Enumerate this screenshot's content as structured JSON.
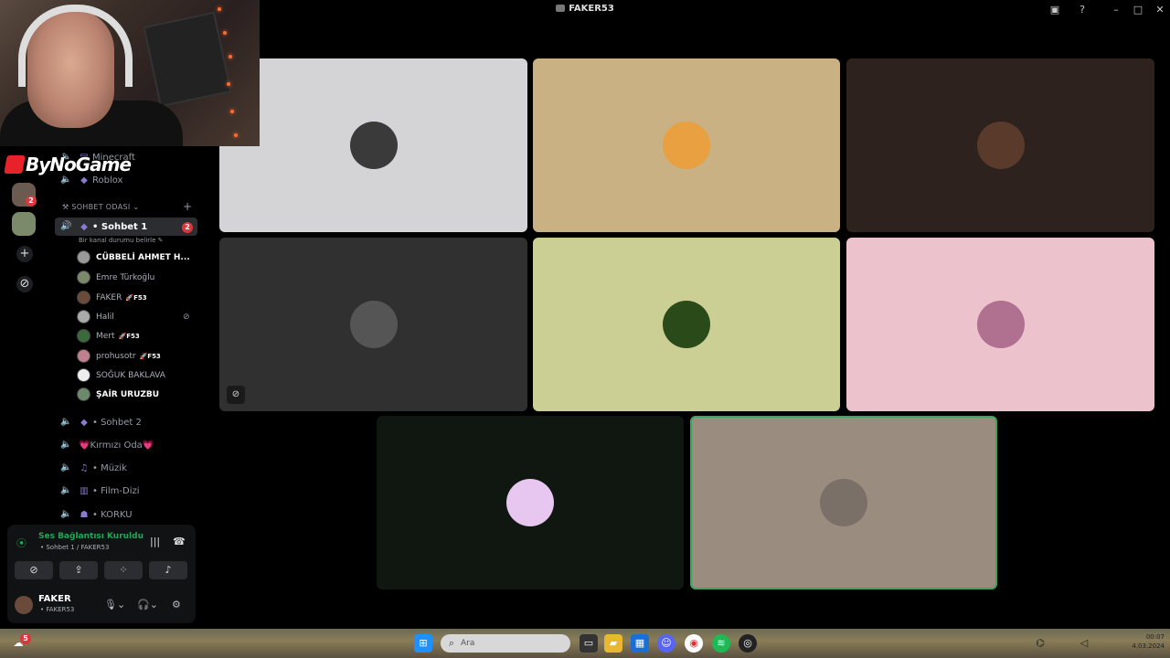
{
  "window": {
    "title": "FAKER53"
  },
  "overlay": {
    "logo_text": "ByNoGame"
  },
  "rail": {
    "badge_count": "2"
  },
  "channels": {
    "top_items": [
      {
        "label": "Minecraft"
      },
      {
        "label": "Roblox"
      }
    ],
    "category": "SOHBET ODASI",
    "active": {
      "label": "• Sohbet 1",
      "badge": "2",
      "status_hint": "Bir kanal durumu belirle"
    },
    "members": [
      {
        "name": "CÜBBELİ AHMET H...",
        "tag": ""
      },
      {
        "name": "Emre Türkoğlu",
        "tag": ""
      },
      {
        "name": "FAKER",
        "tag": "F53"
      },
      {
        "name": "Halil",
        "tag": ""
      },
      {
        "name": "Mert",
        "tag": "F53"
      },
      {
        "name": "prohusotr",
        "tag": "F53"
      },
      {
        "name": "SOĞUK BAKLAVA",
        "tag": ""
      },
      {
        "name": "ŞAİR URUZBU",
        "tag": ""
      }
    ],
    "other": [
      {
        "label": "• Sohbet 2"
      },
      {
        "label": "💗Kırmızı Oda💗"
      },
      {
        "label": "• Müzik"
      },
      {
        "label": "• Film-Dizi"
      },
      {
        "label": "• KORKU"
      }
    ]
  },
  "voice": {
    "status": "Ses Bağlantısı Kuruldu",
    "location": "• Sohbet 1 / FAKER53",
    "user_name": "FAKER",
    "user_sub": "• FAKER53"
  },
  "tiles": [
    {
      "bg": "#d4d4d6",
      "avatar": "#3a3a3a"
    },
    {
      "bg": "#c9b184",
      "avatar": "#e8a040"
    },
    {
      "bg": "#2d221d",
      "avatar": "#5a3a2a"
    },
    {
      "bg": "#303030",
      "avatar": "#555555"
    },
    {
      "bg": "#cbcf94",
      "avatar": "#2a4a1a"
    },
    {
      "bg": "#ecc2cd",
      "avatar": "#b07090"
    },
    {
      "bg": "#0f1710",
      "avatar": "#e7c6f0"
    },
    {
      "bg": "#9a8d80",
      "avatar": "#7a7068"
    }
  ],
  "taskbar": {
    "search_placeholder": "Ara",
    "notif_badge": "5",
    "clock_time": "00:07",
    "clock_date": "4.03.2024"
  },
  "colors": {
    "accent_green": "#23a55a",
    "badge_red": "#da373c"
  }
}
